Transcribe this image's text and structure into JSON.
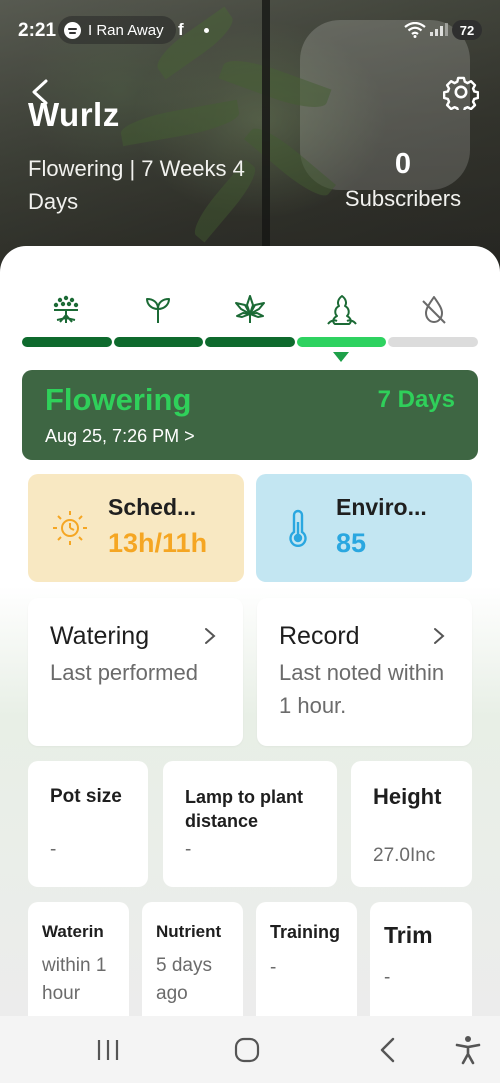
{
  "status_bar": {
    "time": "2:21",
    "media_title": "I Ran Away",
    "app_glyph": "f",
    "battery": "72"
  },
  "header": {
    "plant_name": "Wurlz",
    "stage_summary": "Flowering | 7 Weeks 4 Days",
    "subscribers_count": "0",
    "subscribers_label": "Subscribers"
  },
  "stages": [
    {
      "icon": "germination-icon",
      "state": "done"
    },
    {
      "icon": "seedling-icon",
      "state": "done"
    },
    {
      "icon": "vegetative-leaf-icon",
      "state": "done"
    },
    {
      "icon": "flowering-bud-icon",
      "state": "active"
    },
    {
      "icon": "drying-icon",
      "state": "upcoming"
    }
  ],
  "stage_card": {
    "name": "Flowering",
    "days": "7 Days",
    "date": "Aug 25, 7:26 PM >"
  },
  "schedule": {
    "title": "Sched...",
    "value": "13h/11h",
    "icon": "sun-icon"
  },
  "environment": {
    "title": "Enviro...",
    "value": "85",
    "icon": "thermometer-icon"
  },
  "watering": {
    "title": "Watering",
    "desc": "Last performed"
  },
  "record": {
    "title": "Record",
    "desc": "Last noted within 1 hour."
  },
  "info": {
    "pot_size": {
      "title": "Pot size",
      "value": "-"
    },
    "lamp_distance": {
      "title": "Lamp to plant distance",
      "value": "-"
    },
    "height": {
      "title": "Height",
      "value": "27.0Inc"
    }
  },
  "recent": {
    "watering": {
      "title": "Waterin",
      "value": "within 1 hour"
    },
    "nutrient": {
      "title": "Nutrient",
      "value": "5 days ago"
    },
    "training": {
      "title": "Training",
      "value": "-"
    },
    "trim": {
      "title": "Trim",
      "value": "-"
    }
  },
  "colors": {
    "brand_dark": "#3e6643",
    "brand_green": "#2fd05a",
    "progress_done": "#0e6a2d",
    "schedule_bg": "#f8e8c2",
    "schedule_accent": "#f5a623",
    "environment_bg": "#c3e6f2",
    "environment_accent": "#2aa7e0"
  }
}
